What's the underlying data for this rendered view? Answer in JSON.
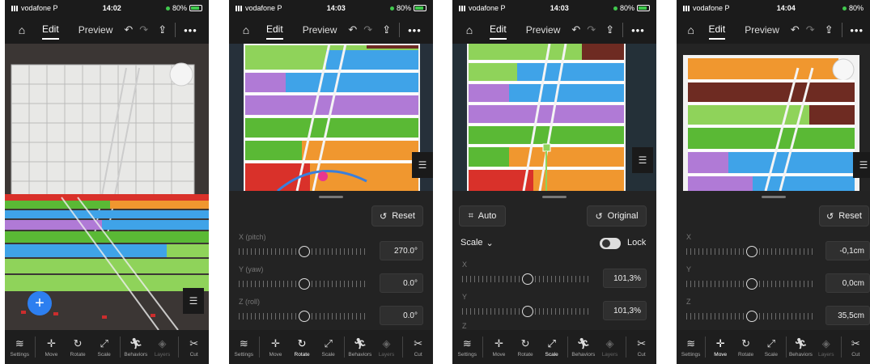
{
  "status": {
    "carrier": "vodafone P",
    "battery": "80%",
    "times": [
      "14:02",
      "14:03",
      "14:03",
      "14:04"
    ]
  },
  "topbar": {
    "edit_label": "Edit",
    "preview_label": "Preview"
  },
  "toolbar_items": [
    "Settings",
    "Move",
    "Rotate",
    "Scale",
    "Behaviors",
    "Layers",
    "Cut"
  ],
  "screen2": {
    "reset_label": "Reset",
    "x_label": "X (pitch)",
    "x_value": "270.0°",
    "y_label": "Y (yaw)",
    "y_value": "0.0°",
    "z_label": "Z (roll)",
    "z_value": "0.0°",
    "active_tool": "Rotate"
  },
  "screen3": {
    "auto_label": "Auto",
    "original_label": "Original",
    "scale_label": "Scale",
    "lock_label": "Lock",
    "x_label": "X",
    "x_value": "101,3%",
    "y_label": "Y",
    "y_value": "101,3%",
    "z_label": "Z",
    "active_tool": "Scale"
  },
  "screen4": {
    "reset_label": "Reset",
    "x_label": "X",
    "x_value": "-0,1cm",
    "y_label": "Y",
    "y_value": "0,0cm",
    "z_label": "Z",
    "z_value": "35,5cm",
    "active_tool": "Move"
  },
  "colors": {
    "orange": "#f0972f",
    "green": "#5ab935",
    "blue": "#3fa3e8",
    "purple": "#b07ad6",
    "red": "#d9312a",
    "brown": "#6e2b22",
    "lightgreen": "#8fd35a",
    "accent": "#2d7ff0"
  }
}
